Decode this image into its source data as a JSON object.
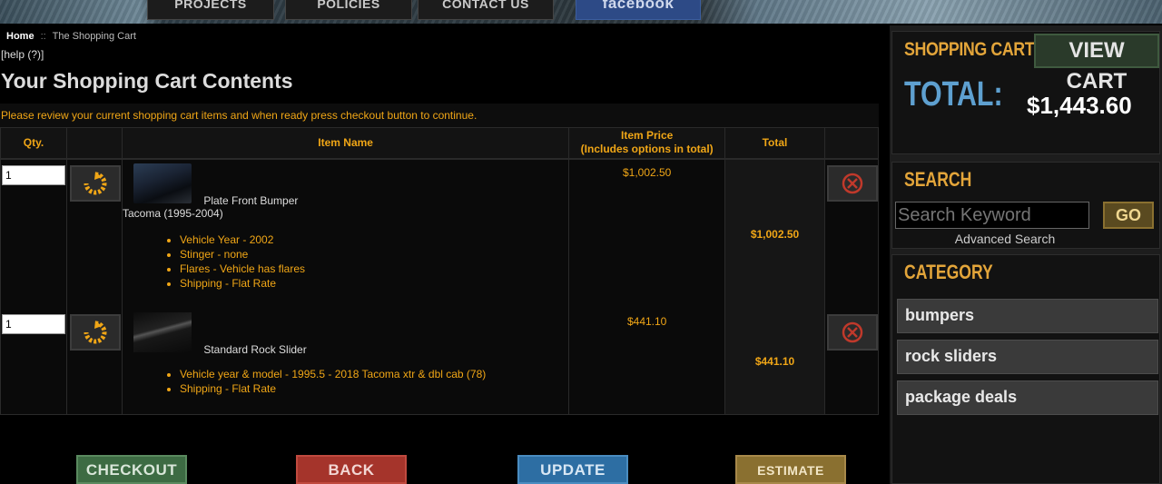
{
  "nav": {
    "projects": "PROJECTS",
    "policies": "POLICIES",
    "contact": "CONTACT US",
    "facebook": "facebook"
  },
  "breadcrumb": {
    "home": "Home",
    "separator": "::",
    "current": "The Shopping Cart"
  },
  "help": "[help (?)]",
  "page_title": "Your Shopping Cart Contents",
  "instructions": "Please review your current shopping cart items and when ready press checkout button to continue.",
  "table": {
    "headers": {
      "qty": "Qty.",
      "item_name": "Item Name",
      "item_price_1": "Item Price",
      "item_price_2": "(Includes options in total)",
      "total": "Total"
    },
    "rows": [
      {
        "qty": "1",
        "name_line1": "Plate Front Bumper",
        "name_line2": "Tacoma (1995-2004)",
        "options": [
          "Vehicle Year - 2002",
          "Stinger - none",
          "Flares - Vehicle has flares",
          "Shipping - Flat Rate"
        ],
        "unit_price": "$1,002.50",
        "total": "$1,002.50"
      },
      {
        "qty": "1",
        "name_line1": "Standard Rock Slider",
        "name_line2": "",
        "options": [
          "Vehicle year & model - 1995.5 - 2018 Tacoma xtr & dbl cab (78)",
          "Shipping - Flat Rate"
        ],
        "unit_price": "$441.10",
        "total": "$441.10"
      }
    ]
  },
  "buttons": {
    "checkout": "CHECKOUT",
    "back": "BACK",
    "update": "UPDATE",
    "estimate_shipping": "ESTIMATE SHIPPING"
  },
  "sidebar": {
    "cart": {
      "heading": "SHOPPING CART",
      "view_cart": "VIEW CART",
      "total_label": "TOTAL:",
      "total_value": "$1,443.60"
    },
    "search": {
      "heading": "SEARCH",
      "placeholder": "Search Keyword",
      "go": "GO",
      "advanced": "Advanced Search"
    },
    "category": {
      "heading": "CATEGORY",
      "items": [
        "bumpers",
        "rock sliders",
        "package deals"
      ]
    }
  },
  "colors": {
    "accent": "#f0a616",
    "total_label": "#5ea0d0",
    "heading": "#e3a53a"
  },
  "icons": {
    "refresh": "refresh-icon",
    "delete": "delete-icon"
  }
}
